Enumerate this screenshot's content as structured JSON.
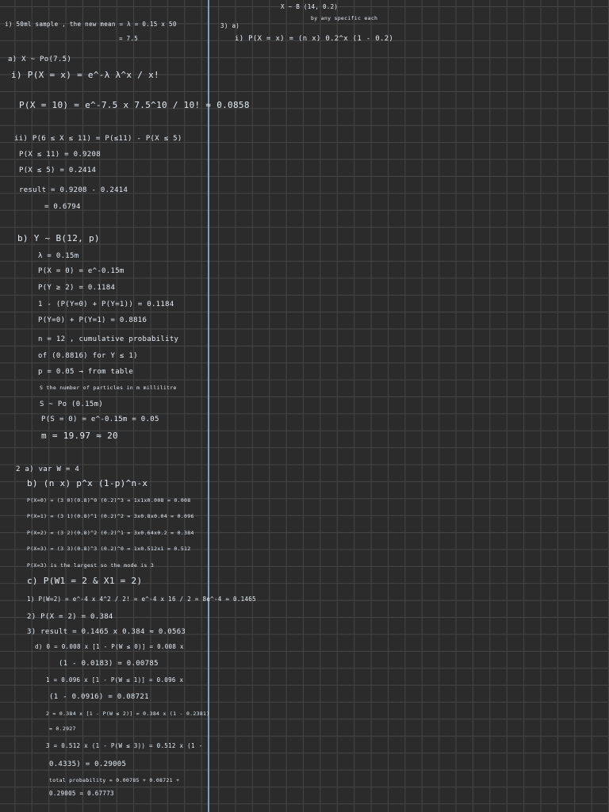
{
  "page": {
    "background_color": "#2b2b2b",
    "grid_color": "#454545",
    "margin_line_color": "#8fb3d1",
    "ink_color": "#e6edf3"
  },
  "left_column": {
    "lines": [
      "i) 50ml sample , the new mean = λ = 0.15 x 50",
      "= 7.5",
      "a) X ~ Po(7.5)",
      "i) P(X = x) = e^-λ λ^x / x!",
      "P(X = 10) = e^-7.5 x 7.5^10 / 10! ≈ 0.0858",
      "ii) P(6 ≤ X ≤ 11) = P(≤11) - P(X ≤ 5)",
      "P(X ≤ 11) = 0.9208",
      "P(X ≤ 5) = 0.2414",
      "result = 0.9208 - 0.2414",
      "= 0.6794",
      "b) Y ~ B(12, p)",
      "λ = 0.15m",
      "P(X = 0) = e^-0.15m",
      "P(Y ≥ 2) = 0.1184",
      "1 - (P(Y=0) + P(Y=1)) = 0.1184",
      "P(Y=0) + P(Y=1) = 0.8816",
      "n = 12 , cumulative probability",
      "of (0.8816) for Y ≤ 1)",
      "p = 0.05 → from table",
      "S the number of particles in m millilitre",
      "S ~ Po (0.15m)",
      "P(S = 0) = e^-0.15m = 0.05",
      "m = 19.97 ≈ 20",
      "2 a) var W = 4",
      "b) (n x) p^x (1-p)^n-x",
      "P(X=0) = (3 0)(0.8)^0 (0.2)^3 = 1x1x0.008 = 0.008",
      "P(X=1) = (3 1)(0.8)^1 (0.2)^2 = 3x0.8x0.04 = 0.096",
      "P(X=2) = (3 2)(0.8)^2 (0.2)^1 = 3x0.64x0.2 = 0.384",
      "P(X=3) = (3 3)(0.8)^3 (0.2)^0 = 1x0.512x1 = 0.512",
      "P(X=3) is the largest so the mode is 3",
      "c) P(W1 = 2 & X1 = 2)",
      "1) P(W=2) = e^-4 x 4^2 / 2! = e^-4 x 16 / 2 = 8e^-4 ≈ 0.1465",
      "2) P(X = 2) = 0.384",
      "3) result = 0.1465 x 0.384 ≈ 0.0563",
      "d) 0 = 0.008 x [1 - P(W ≤ 0)] = 0.008 x",
      "(1 - 0.0183) = 0.00785",
      "1 = 0.096 x [1 - P(W ≤ 1)] = 0.096 x",
      "(1 - 0.0916) = 0.08721",
      "2 = 0.384 x [1 - P(W ≤ 2)] = 0.384 x (1 - 0.2381)",
      "= 0.2927",
      "3 = 0.512 x (1 - P(W ≤ 3)) = 0.512 x (1 -",
      "0.4335) = 0.29005",
      "total probability = 0.00785 + 0.08721 +",
      "0.29005 = 0.67773"
    ]
  },
  "right_column": {
    "lines": [
      "X ~ B (14, 0.2)",
      "by any specific each",
      "3) a)",
      "i) P(X = x) = (n x) 0.2^x (1 - 0.2)"
    ]
  }
}
